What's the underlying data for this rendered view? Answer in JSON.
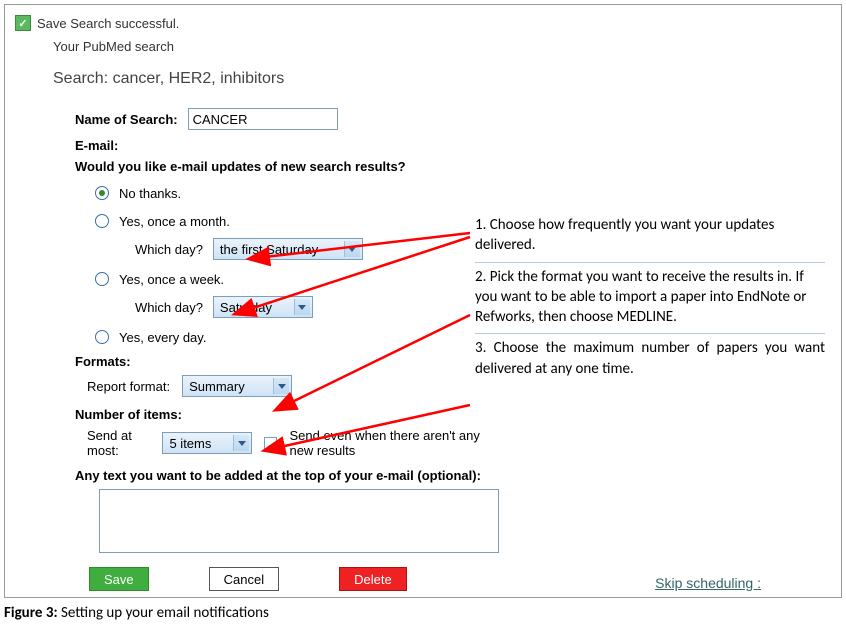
{
  "status": {
    "icon_name": "check-icon",
    "text": "Save Search successful."
  },
  "subheading": "Your PubMed search",
  "search_line": "Search: cancer, HER2, inhibitors",
  "name_of_search": {
    "label": "Name of Search:",
    "value": "CANCER"
  },
  "email_label": "E-mail:",
  "question": "Would you like e-mail updates of new search results?",
  "radios": {
    "no_thanks": "No thanks.",
    "once_month": "Yes, once a month.",
    "which_day_month_label": "Which day?",
    "which_day_month_value": "the first Saturday",
    "once_week": "Yes, once a week.",
    "which_day_week_label": "Which day?",
    "which_day_week_value": "Saturday",
    "every_day": "Yes, every day."
  },
  "formats": {
    "heading": "Formats:",
    "label": "Report format:",
    "value": "Summary"
  },
  "items": {
    "heading": "Number of items:",
    "label": "Send at most:",
    "value": "5 items",
    "checkbox_label": "Send even when there aren't any new results"
  },
  "extra_text_label": "Any text you want to be added at the top of your e-mail (optional):",
  "buttons": {
    "save": "Save",
    "cancel": "Cancel",
    "delete": "Delete"
  },
  "skip_link": "Skip scheduling :",
  "annotations": {
    "a1": "1. Choose how frequently you want your updates delivered.",
    "a2": "2. Pick the format you want to receive the results in. If you want to be able to import a paper into EndNote or Refworks, then choose MEDLINE.",
    "a3": "3. Choose the maximum number of papers you want delivered at any one time."
  },
  "caption_label": "Figure 3:",
  "caption_text": " Setting up your email notifications"
}
